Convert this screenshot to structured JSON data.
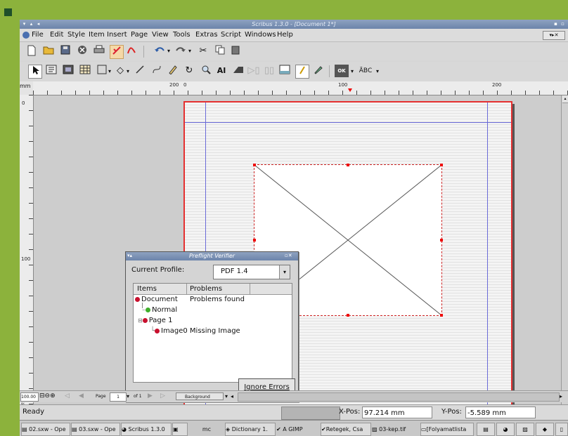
{
  "window": {
    "title": "Scribus 1.3.0 - [Document 1*]",
    "controls": [
      "▾",
      "▴",
      "◂",
      "▪",
      "▫"
    ]
  },
  "menu": [
    "File",
    "Edit",
    "Style",
    "Item",
    "Insert",
    "Page",
    "View",
    "Tools",
    "Extras",
    "Script",
    "Windows",
    "Help"
  ],
  "toolbar1_icons": [
    "new-doc-icon",
    "open-icon",
    "save-icon",
    "close-icon",
    "print-icon",
    "preflight-icon",
    "pdf-icon",
    "undo-icon",
    "redo-icon",
    "cut-icon",
    "copy-icon",
    "paste-icon"
  ],
  "toolbar2_icons": [
    "select-icon",
    "text-frame-icon",
    "image-frame-icon",
    "table-icon",
    "shape-icon",
    "polygon-icon",
    "line-icon",
    "bezier-icon",
    "freehand-icon",
    "rotate-icon",
    "zoom-icon",
    "edit-text-icon",
    "link-icon",
    "unlink-icon",
    "measure-icon",
    "copy-props-icon",
    "eyedropper-icon",
    "pdf-button-icon",
    "spellcheck-icon"
  ],
  "toolbar2_labels": {
    "ok": "OK",
    "abc": "ÄBC"
  },
  "ruler": {
    "unit": "mm",
    "h_labels": [
      "200",
      "0",
      "100",
      "200"
    ],
    "v_labels": [
      "0",
      "100"
    ]
  },
  "preflight": {
    "title": "Preflight Verifier",
    "profile_label": "Current Profile:",
    "profile_value": "PDF 1.4",
    "col_items": "Items",
    "col_problems": "Problems",
    "rows": [
      {
        "item": "Document",
        "problem": "Problems found",
        "status": "error"
      },
      {
        "item": "Normal",
        "problem": "",
        "status": "ok"
      },
      {
        "item": "Page 1",
        "problem": "",
        "status": "error"
      },
      {
        "item": "Image0",
        "problem": "Missing Image",
        "status": "error"
      }
    ],
    "ignore_button": "Ignore Errors"
  },
  "navbar": {
    "zoom": "100.00 %",
    "page_label": "Page",
    "page_value": "1",
    "of_label": "of 1",
    "layer": "Background"
  },
  "status": {
    "text": "Ready",
    "xpos_label": "X-Pos:",
    "xpos_value": "97.214 mm",
    "ypos_label": "Y-Pos:",
    "ypos_value": "-5.589 mm"
  },
  "taskbar": [
    "02.sxw - Ope",
    "03.sxw - Ope",
    "Scribus 1.3.0",
    "mc",
    "Dictionary 1.",
    "A GIMP",
    "Retegek, Csa",
    "03-kep.tif",
    "[Folyamatlista",
    "",
    "",
    "",
    ""
  ],
  "colors": {
    "accent_red": "#e53030",
    "green_frame": "#8cb23c",
    "ok": "#3fae2a",
    "error": "#c8102e"
  }
}
